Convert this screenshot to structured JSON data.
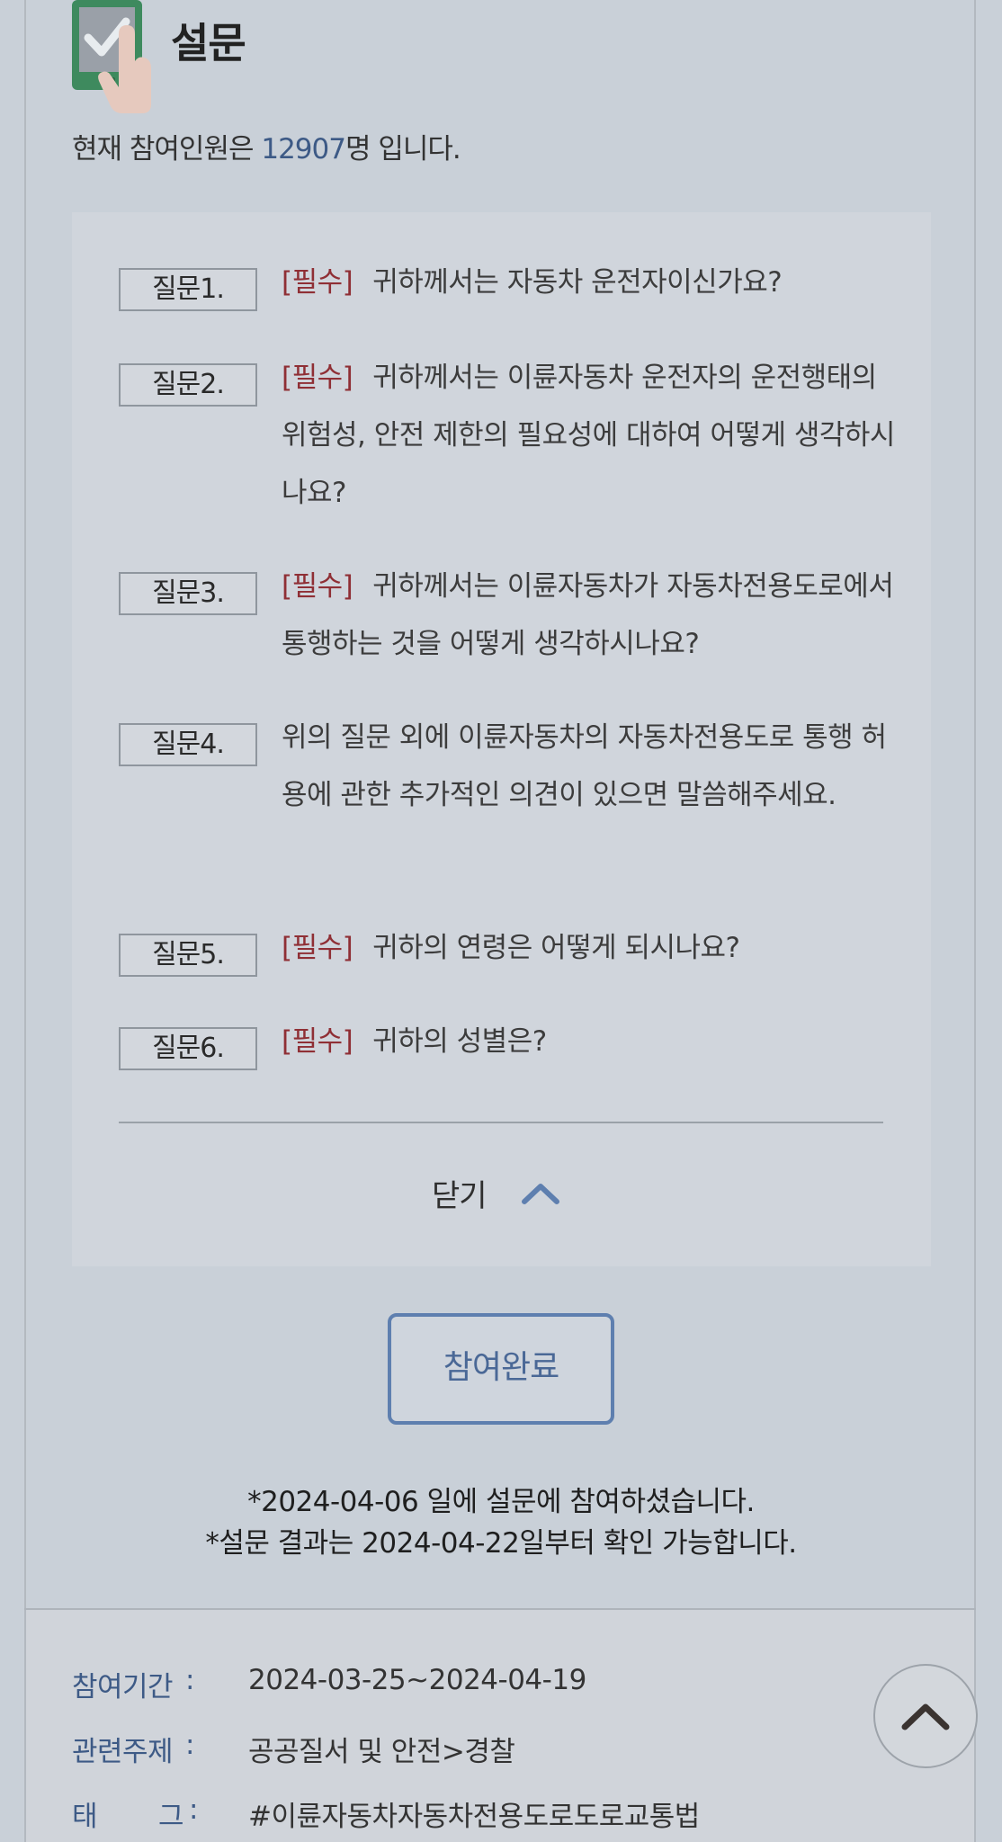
{
  "header": {
    "title": "설문",
    "participants_prefix": "현재 참여인원은 ",
    "participants_count": "12907",
    "participants_suffix": "명 입니다."
  },
  "questions": [
    {
      "label": "질문1.",
      "required": "[필수]",
      "text": "귀하께서는 자동차 운전자이신가요?"
    },
    {
      "label": "질문2.",
      "required": "[필수]",
      "text": "귀하께서는 이륜자동차 운전자의 운전행태의 위험성, 안전 제한의 필요성에 대하여 어떻게 생각하시나요?"
    },
    {
      "label": "질문3.",
      "required": "[필수]",
      "text": "귀하께서는 이륜자동차가 자동차전용도로에서 통행하는 것을 어떻게 생각하시나요?"
    },
    {
      "label": "질문4.",
      "required": "",
      "text": "위의 질문 외에 이륜자동차의 자동차전용도로 통행 허용에 관한 추가적인 의견이 있으면 말씀해주세요."
    },
    {
      "label": "질문5.",
      "required": "[필수]",
      "text": "귀하의 연령은 어떻게 되시나요?"
    },
    {
      "label": "질문6.",
      "required": "[필수]",
      "text": "귀하의 성별은?"
    }
  ],
  "close_label": "닫기",
  "complete_label": "참여완료",
  "notices": [
    "*2024-04-06 일에 설문에 참여하셨습니다.",
    "*설문 결과는 2024-04-22일부터 확인 가능합니다."
  ],
  "info": {
    "period_label": "참여기간",
    "period_value": "2024-03-25~2024-04-19",
    "topic_label": "관련주제",
    "topic_value": "공공질서 및 안전>경찰",
    "tag_label_1": "태",
    "tag_label_2": "그",
    "tag_value": "#이륜자동차자동차전용도로도로교통법",
    "colon": ":"
  },
  "colors": {
    "accent": "#3d5a86",
    "required": "#8f2f35",
    "button_border": "#5e7faf"
  },
  "icons": {
    "survey": "tablet-check-hand-icon",
    "close": "chevron-up-icon",
    "scroll_top": "chevron-up-icon"
  }
}
